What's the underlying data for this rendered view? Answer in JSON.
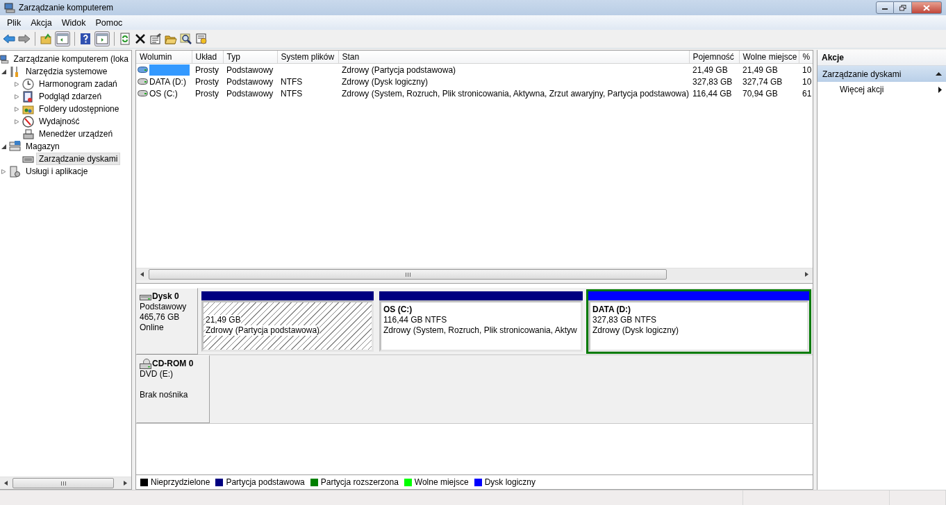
{
  "window": {
    "title": "Zarządzanie komputerem"
  },
  "menu": [
    "Plik",
    "Akcja",
    "Widok",
    "Pomoc"
  ],
  "tree": [
    {
      "label": "Zarządzanie komputerem (loka",
      "selected": false,
      "children": [
        {
          "label": "Narzędzia systemowe",
          "selected": false,
          "expanded": true,
          "children": [
            {
              "label": "Harmonogram zadań",
              "selected": false,
              "expanded": false
            },
            {
              "label": "Podgląd zdarzeń",
              "selected": false,
              "expanded": false
            },
            {
              "label": "Foldery udostępnione",
              "selected": false,
              "expanded": false
            },
            {
              "label": "Wydajność",
              "selected": false,
              "expanded": false
            },
            {
              "label": "Menedżer urządzeń",
              "selected": false
            }
          ]
        },
        {
          "label": "Magazyn",
          "selected": false,
          "expanded": true,
          "children": [
            {
              "label": "Zarządzanie dyskami",
              "selected": true
            }
          ]
        },
        {
          "label": "Usługi i aplikacje",
          "selected": false,
          "expanded": false
        }
      ]
    }
  ],
  "volumes": {
    "columns": [
      "Wolumin",
      "Układ",
      "Typ",
      "System plików",
      "Stan",
      "Pojemność",
      "Wolne miejsce",
      "%"
    ],
    "rows": [
      {
        "selected": true,
        "layout": "Prosty",
        "type": "Podstawowy",
        "status": "Zdrowy (Partycja podstawowa)",
        "capacity": "21,49 GB",
        "free": "21,49 GB",
        "percent": "10"
      },
      {
        "selected": false,
        "volume": "DATA (D:)",
        "layout": "Prosty",
        "type": "Podstawowy",
        "fs": "NTFS",
        "status": "Zdrowy (Dysk logiczny)",
        "capacity": "327,83 GB",
        "free": "327,74 GB",
        "percent": "10"
      },
      {
        "selected": false,
        "volume": "OS (C:)",
        "layout": "Prosty",
        "type": "Podstawowy",
        "fs": "NTFS",
        "status": "Zdrowy (System, Rozruch, Plik stronicowania, Aktywna, Zrzut awaryjny, Partycja podstawowa)",
        "capacity": "116,44 GB",
        "free": "70,94 GB",
        "percent": "61"
      }
    ]
  },
  "disks": [
    {
      "kind": "hdd",
      "name": "Dysk 0",
      "type": "Podstawowy",
      "size": "465,76 GB",
      "status": "Online",
      "partitions": [
        {
          "color": "#000080",
          "hatched": true,
          "selected": false,
          "size": "21,49 GB",
          "health": "Zdrowy (Partycja podstawowa)"
        },
        {
          "color": "#000080",
          "hatched": false,
          "selected": false,
          "name": "OS  (C:)",
          "size": "116,44 GB NTFS",
          "health": "Zdrowy (System, Rozruch, Plik stronicowania, Aktyw"
        },
        {
          "color": "#0000ff",
          "hatched": false,
          "selected": true,
          "name": "DATA  (D:)",
          "size": "327,83 GB NTFS",
          "health": "Zdrowy (Dysk logiczny)"
        }
      ]
    },
    {
      "kind": "cdrom",
      "name": "CD-ROM 0",
      "type": "DVD (E:)",
      "status": "Brak nośnika"
    }
  ],
  "legend": [
    {
      "label": "Nieprzydzielone",
      "color": "#000000"
    },
    {
      "label": "Partycja podstawowa",
      "color": "#000080"
    },
    {
      "label": "Partycja rozszerzona",
      "color": "#008000"
    },
    {
      "label": "Wolne miejsce",
      "color": "#00ff00"
    },
    {
      "label": "Dysk logiczny",
      "color": "#0000ff"
    }
  ],
  "actions": {
    "title": "Akcje",
    "sections": [
      {
        "title": "Zarządzanie dyskami",
        "expanded": true,
        "items": [
          "Więcej akcji"
        ]
      }
    ]
  }
}
